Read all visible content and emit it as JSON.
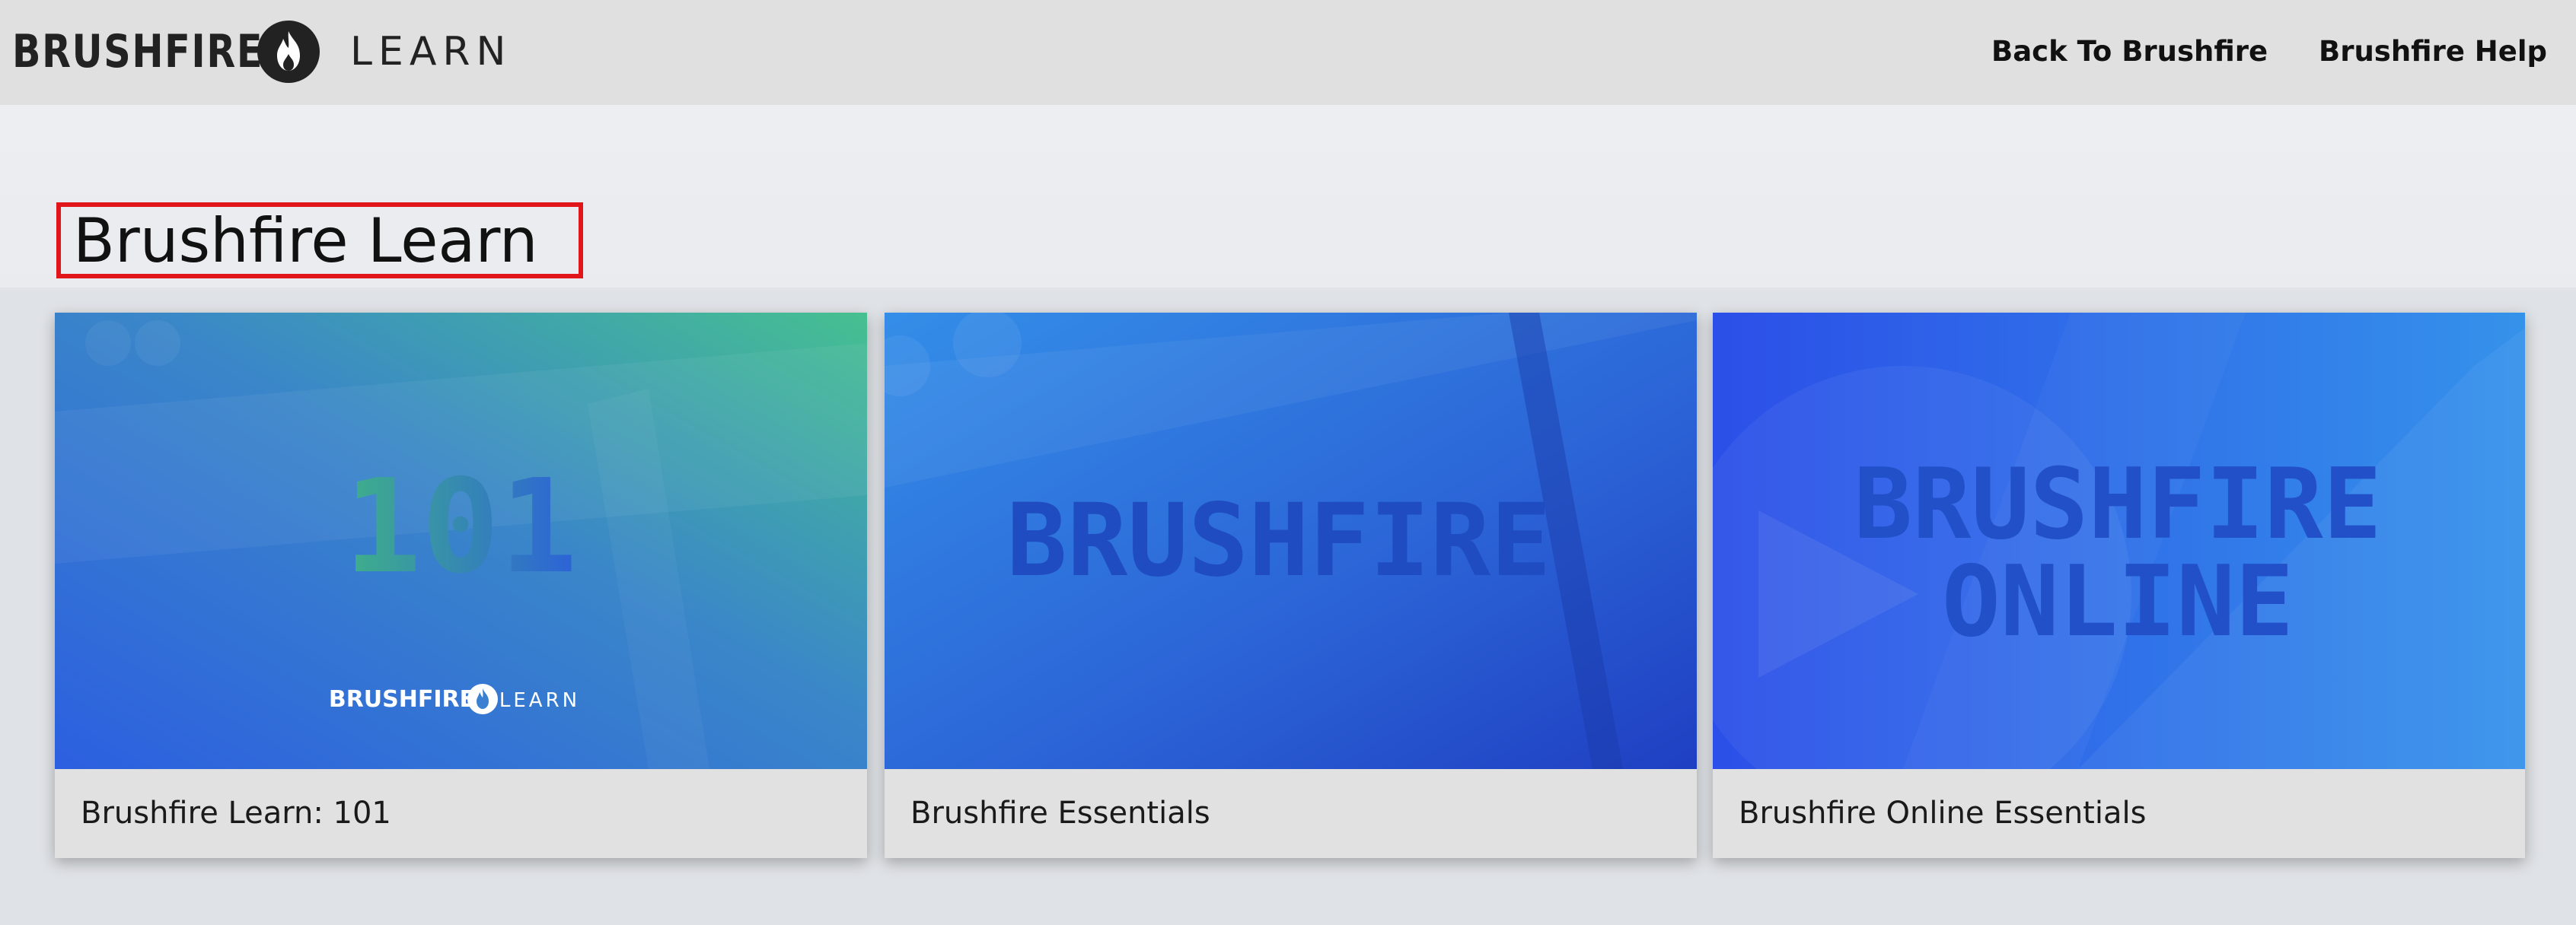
{
  "header": {
    "brand_name": "BRUSHFIRE",
    "brand_product": "LEARN",
    "logo_icon": "flame-icon",
    "nav": [
      {
        "label": "Back To Brushfire"
      },
      {
        "label": "Brushfire Help"
      }
    ]
  },
  "main": {
    "title": "Brushfire Learn",
    "courses": [
      {
        "label": "Brushfire Learn: 101",
        "thumb_text": "101",
        "thumb_brand": "BRUSHFIRE",
        "thumb_product": "LEARN"
      },
      {
        "label": "Brushfire Essentials",
        "thumb_text": "BRUSHFIRE"
      },
      {
        "label": "Brushfire Online Essentials",
        "thumb_text_line1": "BRUSHFIRE",
        "thumb_text_line2": "ONLINE"
      }
    ]
  },
  "colors": {
    "highlight_border": "#e0161b",
    "header_bg": "#e0e0e0",
    "card_label_bg": "#e1e1e1"
  }
}
